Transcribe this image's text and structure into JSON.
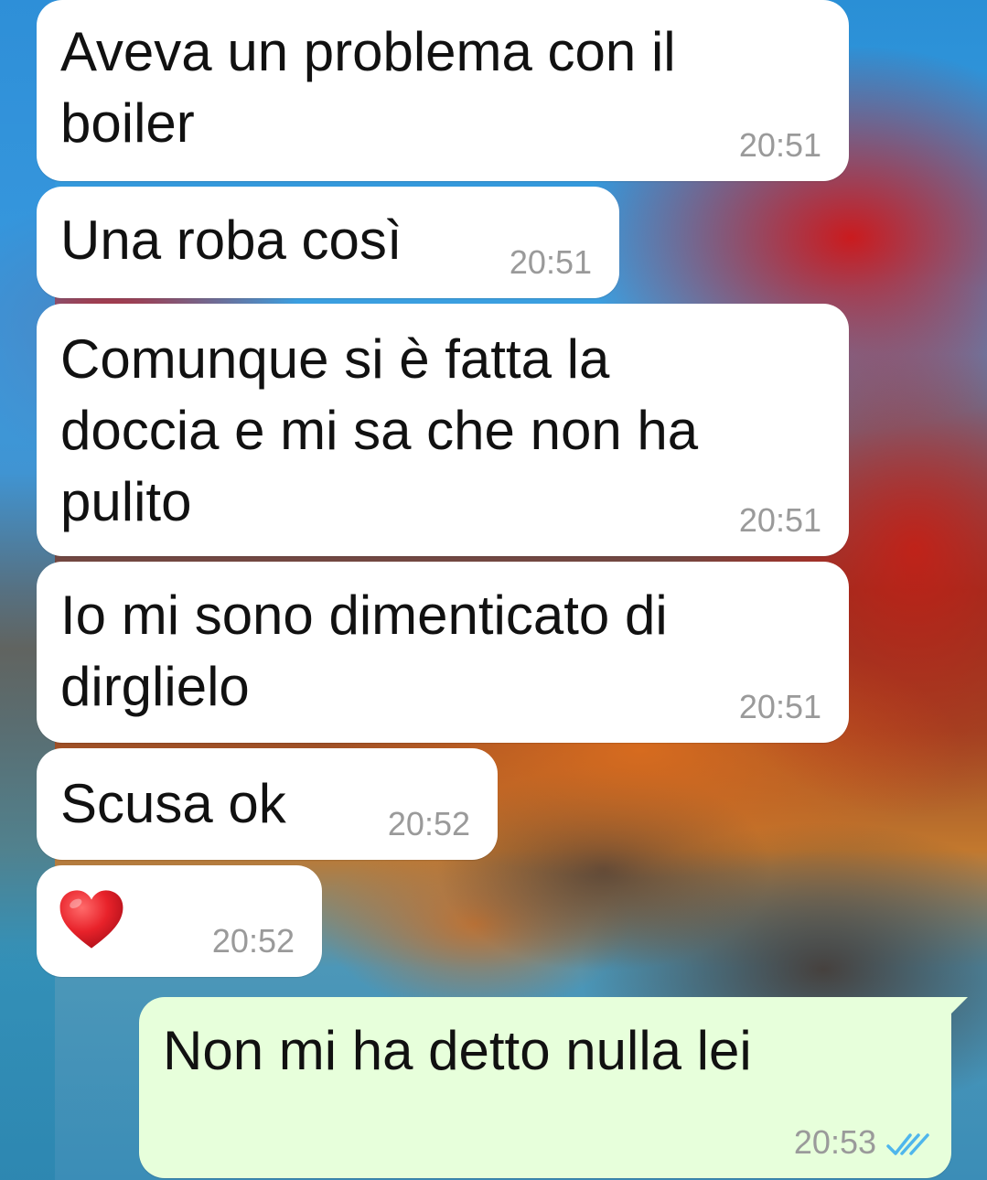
{
  "colors": {
    "incoming_bubble": "#ffffff",
    "outgoing_bubble": "#e7ffdb",
    "timestamp": "#9a9a9a",
    "read_ticks": "#4fb6ec"
  },
  "messages": [
    {
      "direction": "incoming",
      "text": "Aveva un problema con il\nboiler",
      "time": "20:51"
    },
    {
      "direction": "incoming",
      "text": "Una roba così",
      "time": "20:51"
    },
    {
      "direction": "incoming",
      "text": "Comunque si è fatta la\ndoccia e mi sa che non ha\npulito",
      "time": "20:51"
    },
    {
      "direction": "incoming",
      "text": "Io mi sono dimenticato di\ndirglielo",
      "time": "20:51"
    },
    {
      "direction": "incoming",
      "text": "Scusa ok",
      "time": "20:52"
    },
    {
      "direction": "incoming",
      "emoji": "red-heart",
      "time": "20:52"
    },
    {
      "direction": "outgoing",
      "text": "Non mi ha detto nulla lei",
      "time": "20:53",
      "status": "read-double-check-icon"
    }
  ]
}
